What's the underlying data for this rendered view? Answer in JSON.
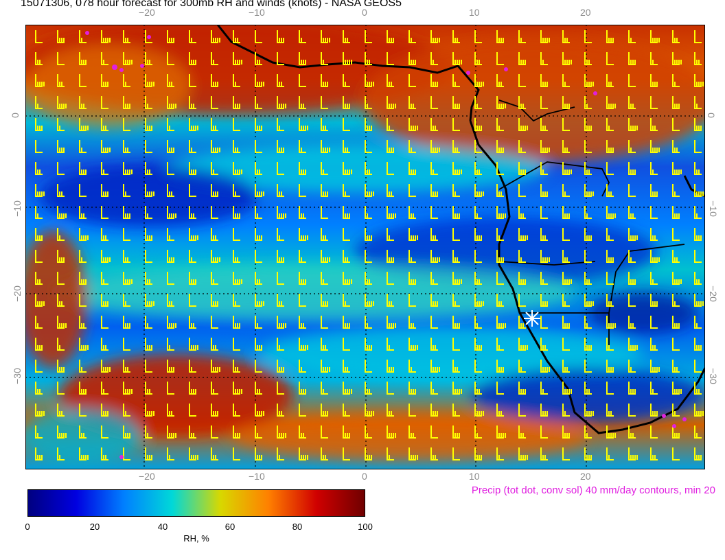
{
  "title": "15071306, 078 hour forecast for 300mb RH and winds (knots) - NASA GEOS5",
  "map": {
    "projection": "lat-lon",
    "lon_range": [
      -31,
      31
    ],
    "lat_range": [
      -40,
      9
    ],
    "top_lon_ticks": [
      "−20",
      "−10",
      "0",
      "10",
      "20"
    ],
    "bottom_lon_ticks": [
      "−20",
      "−10",
      "0",
      "10",
      "20"
    ],
    "left_lat_ticks": [
      "0",
      "−10",
      "−20",
      "−30"
    ],
    "right_lat_ticks": [
      "0",
      "−10",
      "−20",
      "−30"
    ],
    "field": "300mb relative humidity with wind barbs",
    "marker": "white star near Namibian coast",
    "colors": {
      "barb": "#ffff00",
      "coast": "#000000",
      "precip": "#e020e0",
      "grid": "#000000"
    }
  },
  "colorbar": {
    "ticks": [
      "0",
      "20",
      "40",
      "60",
      "80",
      "100"
    ],
    "label": "RH, %",
    "stops": [
      "#000080",
      "#0000e0",
      "#0080ff",
      "#00d8d8",
      "#d8d800",
      "#ff8000",
      "#d00000",
      "#700000"
    ]
  },
  "precip_note": "Precip (tot dot, conv sol) 40 mm/day contours, min 20"
}
